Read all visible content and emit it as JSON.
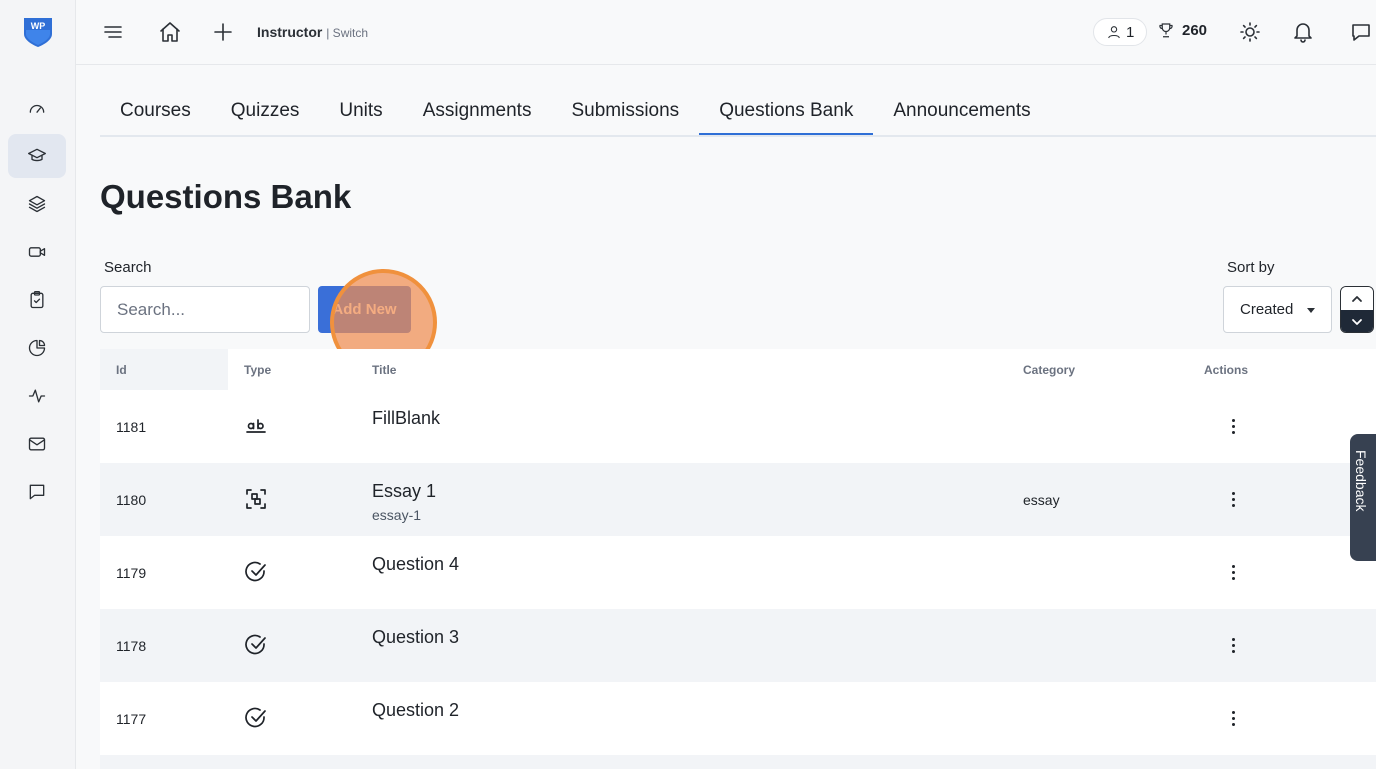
{
  "brand": {
    "logo_text": "WP",
    "accent": "#2f6fd6"
  },
  "topbar": {
    "role": "Instructor",
    "switch": "| Switch",
    "users_count": "1",
    "points": "260"
  },
  "tabs": [
    {
      "label": "Courses"
    },
    {
      "label": "Quizzes"
    },
    {
      "label": "Units"
    },
    {
      "label": "Assignments"
    },
    {
      "label": "Submissions"
    },
    {
      "label": "Questions Bank",
      "active": true
    },
    {
      "label": "Announcements"
    }
  ],
  "page": {
    "title": "Questions Bank",
    "search_label": "Search",
    "search_placeholder": "Search...",
    "search_value": "",
    "add_new": "Add New",
    "sort_label": "Sort by",
    "sort_value": "Created"
  },
  "table": {
    "headers": {
      "id": "Id",
      "type": "Type",
      "title": "Title",
      "category": "Category",
      "actions": "Actions"
    },
    "rows": [
      {
        "id": "1181",
        "type_icon": "fill-blank-icon",
        "title": "FillBlank",
        "subtitle": "",
        "category": ""
      },
      {
        "id": "1180",
        "type_icon": "essay-icon",
        "title": "Essay 1",
        "subtitle": "essay-1",
        "category": "essay"
      },
      {
        "id": "1179",
        "type_icon": "check-circle-icon",
        "title": "Question 4",
        "subtitle": "",
        "category": ""
      },
      {
        "id": "1178",
        "type_icon": "check-circle-icon",
        "title": "Question 3",
        "subtitle": "",
        "category": ""
      },
      {
        "id": "1177",
        "type_icon": "check-circle-icon",
        "title": "Question 2",
        "subtitle": "",
        "category": ""
      }
    ]
  },
  "feedback": "Feedback"
}
